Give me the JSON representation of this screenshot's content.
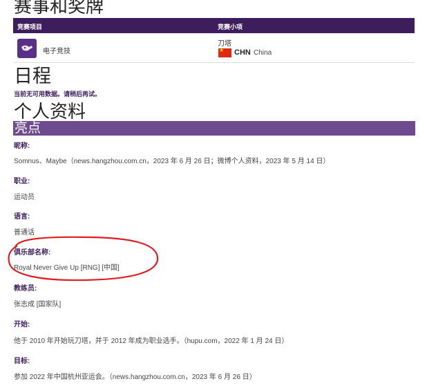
{
  "headings": {
    "medals": "赛事和奖牌",
    "schedule": "日程",
    "profile": "个人资料"
  },
  "medals_table": {
    "col_sport": "竞赛项目",
    "col_event": "竞赛小项",
    "row": {
      "sport": "电子竞技",
      "event": "刀塔",
      "noc_code": "CHN",
      "noc_name": "China"
    }
  },
  "schedule": {
    "note": "当前无可用数据。请稍后再试。"
  },
  "profile": {
    "section_title": "亮点",
    "fields": [
      {
        "label": "昵称:",
        "value": "Somnus、Maybe（news.hangzhou.com.cn，2023 年 6 月 26 日；微博个人资料，2023 年 5 月 14 日）"
      },
      {
        "label": "职业:",
        "value": "运动员"
      },
      {
        "label": "语言:",
        "value": "普通话"
      },
      {
        "label": "俱乐部名称:",
        "value": "Royal Never Give Up [RNG] [中国]"
      },
      {
        "label": "教练员:",
        "value": "张志成 [国家队]"
      },
      {
        "label": "开始:",
        "value": "他于 2010 年开始玩刀塔，并于 2012 年成为职业选手。（hupu.com，2022 年 1 月 24 日）"
      },
      {
        "label": "目标:",
        "value": "参加 2022 年中国杭州亚运会。（news.hangzhou.com.cn，2023 年 6 月 26 日）"
      }
    ]
  },
  "colors": {
    "header_dark": "#3d1d5c",
    "section_bar": "#6e4a8e",
    "annotation": "#e21b23"
  }
}
